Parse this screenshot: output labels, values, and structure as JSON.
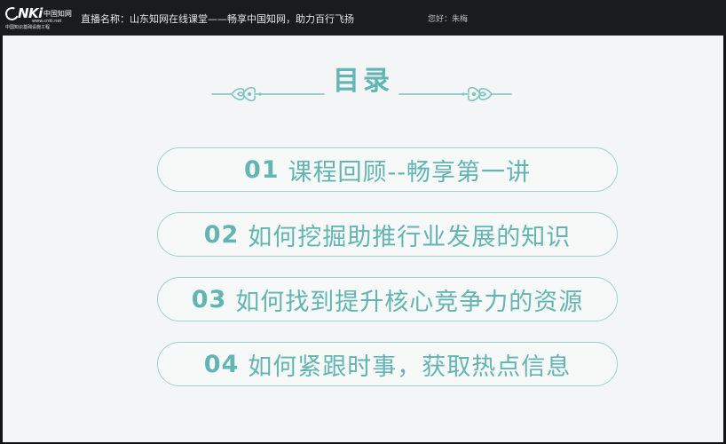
{
  "header": {
    "logo": {
      "brand_latin": "NKi",
      "brand_cn": "中国知网",
      "url": "www.cnki.net",
      "subtitle": "中国知识基础设施工程"
    },
    "broadcast_title": "直播名称：山东知网在线课堂——畅享中国知网，助力百行飞扬",
    "greeting": "您好：朱梅"
  },
  "slide": {
    "title": "目录",
    "accent_color": "#62b5b2",
    "items": [
      {
        "number": "01",
        "text": "课程回顾--畅享第一讲"
      },
      {
        "number": "02",
        "text": "如何挖掘助推行业发展的知识"
      },
      {
        "number": "03",
        "text": "如何找到提升核心竞争力的资源"
      },
      {
        "number": "04",
        "text": "如何紧跟时事，获取热点信息"
      }
    ]
  }
}
